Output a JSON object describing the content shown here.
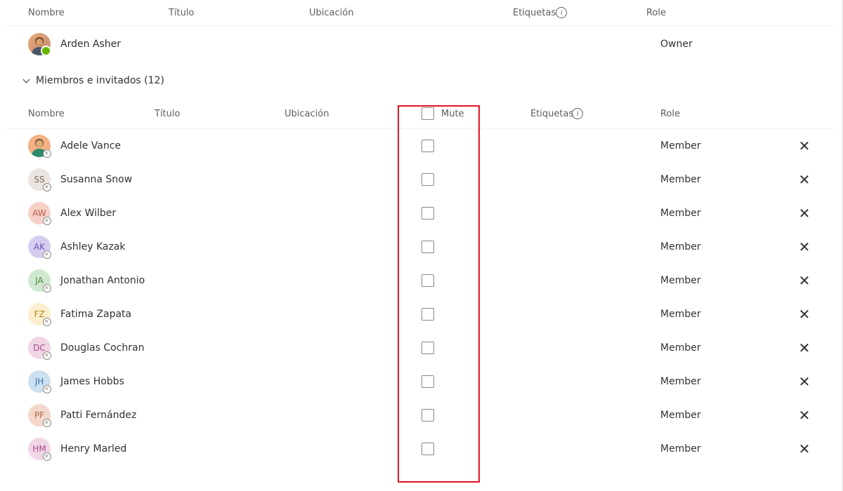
{
  "owners_header": {
    "name": "Nombre",
    "title": "Título",
    "location": "Ubicación",
    "tags": "Etiquetas",
    "role": "Role"
  },
  "owner": {
    "name": "Arden Asher",
    "role": "Owner"
  },
  "section_label": "Miembros e invitados (12)",
  "members_header": {
    "name": "Nombre",
    "title": "Título",
    "location": "Ubicación",
    "mute": "Mute",
    "tags": "Etiquetas",
    "role": "Role"
  },
  "role_member": "Member",
  "members": [
    {
      "name": "Adele Vance",
      "initials": "",
      "photo": true,
      "bg": "#f4b183"
    },
    {
      "name": "Susanna Snow",
      "initials": "SS",
      "photo": false,
      "bg": "#ece4e1",
      "fg": "#7a6a5a"
    },
    {
      "name": "Alex Wilber",
      "initials": "AW",
      "photo": false,
      "bg": "#f7d1c8",
      "fg": "#b55c4a"
    },
    {
      "name": "Ashley Kazak",
      "initials": "AK",
      "photo": false,
      "bg": "#d5ccf0",
      "fg": "#6455b3"
    },
    {
      "name": "Jonathan Antonio",
      "initials": "JA",
      "photo": false,
      "bg": "#d1e8d0",
      "fg": "#4a8a3e"
    },
    {
      "name": "Fatima Zapata",
      "initials": "FZ",
      "photo": false,
      "bg": "#fceece",
      "fg": "#b38819"
    },
    {
      "name": "Douglas Cochran",
      "initials": "DC",
      "photo": false,
      "bg": "#f0d6e6",
      "fg": "#a64d8a"
    },
    {
      "name": "James Hobbs",
      "initials": "JH",
      "photo": false,
      "bg": "#cde0f0",
      "fg": "#3a72b0"
    },
    {
      "name": "Patti Fernández",
      "initials": "PF",
      "photo": false,
      "bg": "#f3d7cb",
      "fg": "#b06a48"
    },
    {
      "name": "Henry Marled",
      "initials": "HM",
      "photo": false,
      "bg": "#f0d6e6",
      "fg": "#a64d8a"
    }
  ]
}
